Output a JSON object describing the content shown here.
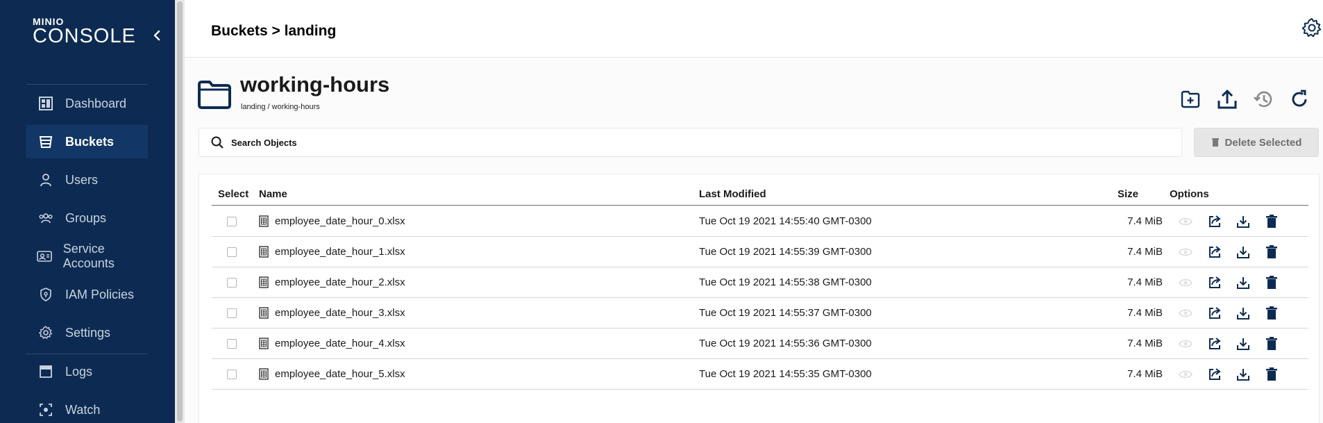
{
  "sidebar": {
    "logo_top": "MINIO",
    "logo_bottom": "CONSOLE",
    "items": [
      {
        "label": "Dashboard",
        "icon": "dashboard-icon"
      },
      {
        "label": "Buckets",
        "icon": "bucket-icon",
        "active": true
      },
      {
        "label": "Users",
        "icon": "user-icon"
      },
      {
        "label": "Groups",
        "icon": "groups-icon"
      },
      {
        "label": "Service Accounts",
        "icon": "service-account-icon"
      },
      {
        "label": "IAM Policies",
        "icon": "policy-shield-icon"
      },
      {
        "label": "Settings",
        "icon": "gear-icon"
      },
      {
        "label": "Logs",
        "icon": "logs-icon"
      },
      {
        "label": "Watch",
        "icon": "watch-icon"
      }
    ]
  },
  "header": {
    "breadcrumb": "Buckets > landing"
  },
  "object": {
    "title": "working-hours",
    "path": "landing / working-hours"
  },
  "search": {
    "placeholder": "Search Objects",
    "value": ""
  },
  "toolbar": {
    "delete_selected_label": "Delete Selected"
  },
  "table": {
    "columns": {
      "select": "Select",
      "name": "Name",
      "last_modified": "Last Modified",
      "size": "Size",
      "options": "Options"
    },
    "rows": [
      {
        "name": "employee_date_hour_0.xlsx",
        "modified": "Tue Oct 19 2021 14:55:40 GMT-0300",
        "size": "7.4 MiB"
      },
      {
        "name": "employee_date_hour_1.xlsx",
        "modified": "Tue Oct 19 2021 14:55:39 GMT-0300",
        "size": "7.4 MiB"
      },
      {
        "name": "employee_date_hour_2.xlsx",
        "modified": "Tue Oct 19 2021 14:55:38 GMT-0300",
        "size": "7.4 MiB"
      },
      {
        "name": "employee_date_hour_3.xlsx",
        "modified": "Tue Oct 19 2021 14:55:37 GMT-0300",
        "size": "7.4 MiB"
      },
      {
        "name": "employee_date_hour_4.xlsx",
        "modified": "Tue Oct 19 2021 14:55:36 GMT-0300",
        "size": "7.4 MiB"
      },
      {
        "name": "employee_date_hour_5.xlsx",
        "modified": "Tue Oct 19 2021 14:55:35 GMT-0300",
        "size": "7.4 MiB"
      }
    ]
  },
  "colors": {
    "sidebar_bg": "#0d2b52",
    "sidebar_active_bg": "#123766",
    "text_primary": "#1a1a1a",
    "icon_dark": "#0d2b52",
    "delete_disabled_bg": "#e6e6e6"
  }
}
